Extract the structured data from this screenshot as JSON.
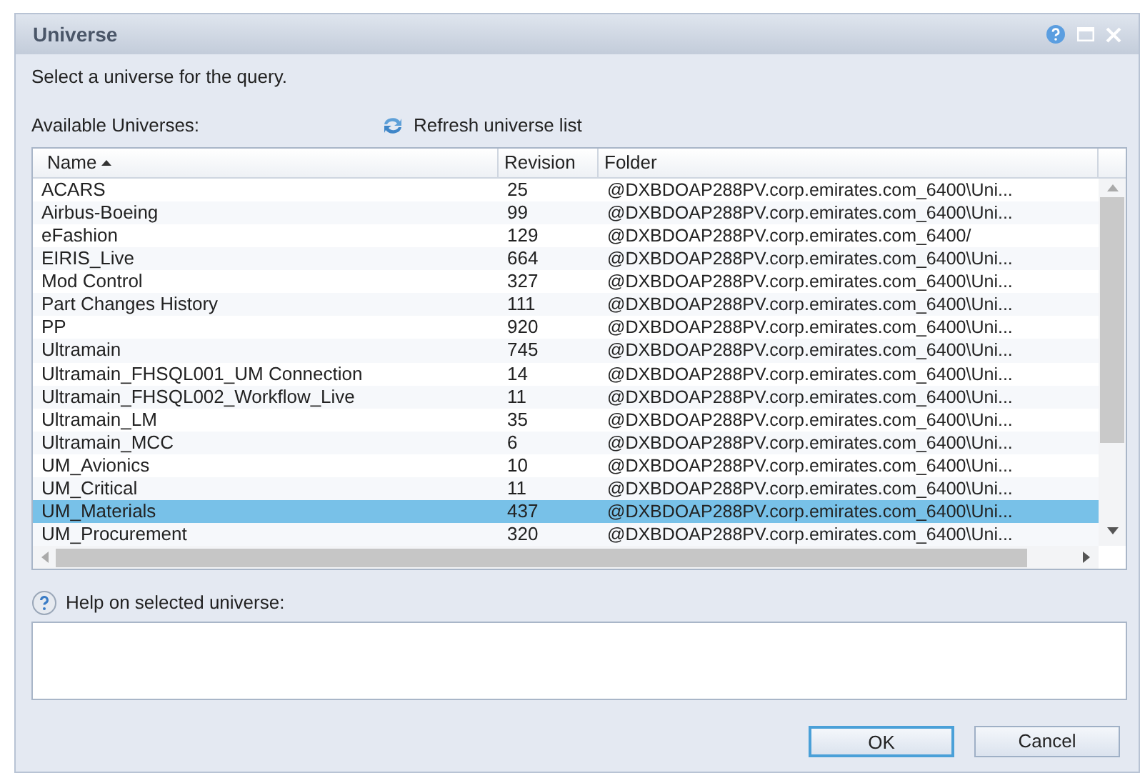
{
  "window": {
    "title": "Universe"
  },
  "instruction": "Select a universe for the query.",
  "list_label": "Available Universes:",
  "refresh_link": "Refresh universe list",
  "table": {
    "columns": [
      {
        "label": "Name",
        "sorted": true
      },
      {
        "label": "Revision",
        "sorted": false
      },
      {
        "label": "Folder",
        "sorted": false
      }
    ],
    "rows": [
      {
        "name": "ACARS",
        "revision": "25",
        "folder": "@DXBDOAP288PV.corp.emirates.com_6400\\Uni...",
        "selected": false
      },
      {
        "name": "Airbus-Boeing",
        "revision": "99",
        "folder": "@DXBDOAP288PV.corp.emirates.com_6400\\Uni...",
        "selected": false
      },
      {
        "name": "eFashion",
        "revision": "129",
        "folder": "@DXBDOAP288PV.corp.emirates.com_6400/",
        "selected": false
      },
      {
        "name": "EIRIS_Live",
        "revision": "664",
        "folder": "@DXBDOAP288PV.corp.emirates.com_6400\\Uni...",
        "selected": false
      },
      {
        "name": "Mod Control",
        "revision": "327",
        "folder": "@DXBDOAP288PV.corp.emirates.com_6400\\Uni...",
        "selected": false
      },
      {
        "name": "Part Changes History",
        "revision": "111",
        "folder": "@DXBDOAP288PV.corp.emirates.com_6400\\Uni...",
        "selected": false
      },
      {
        "name": "PP",
        "revision": "920",
        "folder": "@DXBDOAP288PV.corp.emirates.com_6400\\Uni...",
        "selected": false
      },
      {
        "name": "Ultramain",
        "revision": "745",
        "folder": "@DXBDOAP288PV.corp.emirates.com_6400\\Uni...",
        "selected": false
      },
      {
        "name": "Ultramain_FHSQL001_UM Connection",
        "revision": "14",
        "folder": "@DXBDOAP288PV.corp.emirates.com_6400\\Uni...",
        "selected": false
      },
      {
        "name": "Ultramain_FHSQL002_Workflow_Live",
        "revision": "11",
        "folder": "@DXBDOAP288PV.corp.emirates.com_6400\\Uni...",
        "selected": false
      },
      {
        "name": "Ultramain_LM",
        "revision": "35",
        "folder": "@DXBDOAP288PV.corp.emirates.com_6400\\Uni...",
        "selected": false
      },
      {
        "name": "Ultramain_MCC",
        "revision": "6",
        "folder": "@DXBDOAP288PV.corp.emirates.com_6400\\Uni...",
        "selected": false
      },
      {
        "name": "UM_Avionics",
        "revision": "10",
        "folder": "@DXBDOAP288PV.corp.emirates.com_6400\\Uni...",
        "selected": false
      },
      {
        "name": "UM_Critical",
        "revision": "11",
        "folder": "@DXBDOAP288PV.corp.emirates.com_6400\\Uni...",
        "selected": false
      },
      {
        "name": "UM_Materials",
        "revision": "437",
        "folder": "@DXBDOAP288PV.corp.emirates.com_6400\\Uni...",
        "selected": true
      },
      {
        "name": "UM_Procurement",
        "revision": "320",
        "folder": "@DXBDOAP288PV.corp.emirates.com_6400\\Uni...",
        "selected": false
      }
    ]
  },
  "help_label": "Help on selected universe:",
  "buttons": [
    {
      "label": "OK",
      "kind": "default"
    },
    {
      "label": "Cancel",
      "kind": "normal"
    }
  ]
}
